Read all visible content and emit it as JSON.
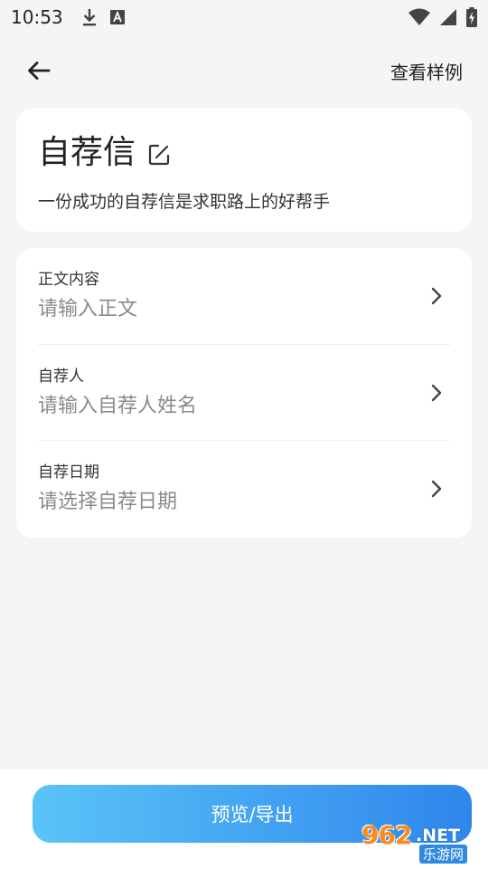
{
  "status_bar": {
    "time": "10:53",
    "icons": [
      "download-icon",
      "a-notification-icon",
      "wifi-icon",
      "signal-icon",
      "battery-charging-icon"
    ]
  },
  "top_bar": {
    "back_icon": "arrow-left-icon",
    "sample_link": "查看样例"
  },
  "header": {
    "title": "自荐信",
    "edit_icon": "edit-icon",
    "subtitle": "一份成功的自荐信是求职路上的好帮手"
  },
  "form": {
    "rows": [
      {
        "label": "正文内容",
        "placeholder": "请输入正文"
      },
      {
        "label": "自荐人",
        "placeholder": "请输入自荐人姓名"
      },
      {
        "label": "自荐日期",
        "placeholder": "请选择自荐日期"
      }
    ]
  },
  "footer": {
    "primary_button": "预览/导出"
  },
  "watermark": {
    "number": "962",
    "suffix": ".NET",
    "site_name": "乐游网"
  },
  "colors": {
    "background": "#f5f5f7",
    "card": "#ffffff",
    "button_gradient_start": "#5ac4f7",
    "button_gradient_end": "#2f86ec",
    "placeholder": "#8a8a8a"
  }
}
